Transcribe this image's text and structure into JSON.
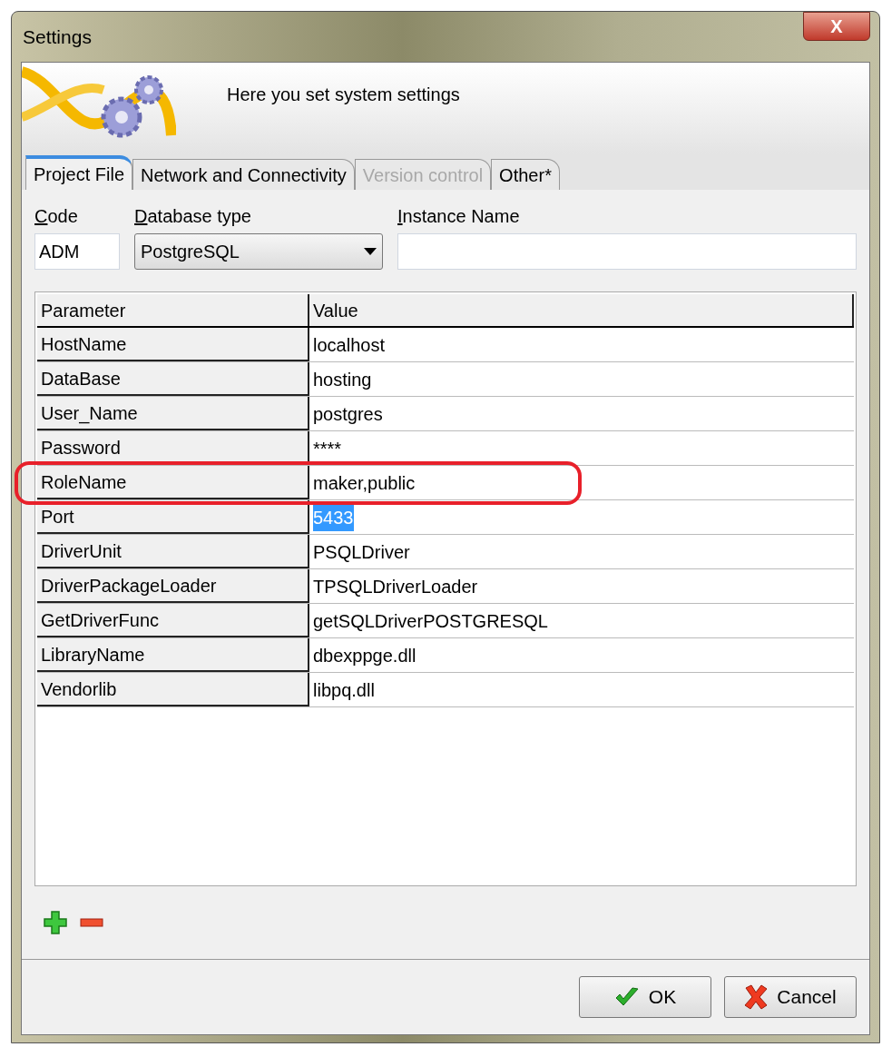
{
  "window": {
    "title": "Settings",
    "close_label": "X"
  },
  "header": {
    "text": "Here you set system settings"
  },
  "tabs": [
    {
      "label": "Project File",
      "selected": true,
      "disabled": false
    },
    {
      "label": "Network and Connectivity",
      "selected": false,
      "disabled": false
    },
    {
      "label": "Version control",
      "selected": false,
      "disabled": true
    },
    {
      "label": "Other*",
      "selected": false,
      "disabled": false
    }
  ],
  "fields": {
    "code": {
      "label": "Code",
      "value": "ADM"
    },
    "database_type": {
      "label": "Database type",
      "value": "PostgreSQL"
    },
    "instance_name": {
      "label": "Instance Name"
    }
  },
  "table": {
    "columns": [
      "Parameter",
      "Value"
    ],
    "rows": [
      {
        "parameter": "HostName",
        "value": "localhost",
        "selected": false
      },
      {
        "parameter": "DataBase",
        "value": "hosting",
        "selected": false
      },
      {
        "parameter": "User_Name",
        "value": "postgres",
        "selected": false
      },
      {
        "parameter": "Password",
        "value": "****",
        "selected": false
      },
      {
        "parameter": "RoleName",
        "value": "maker,public",
        "selected": false
      },
      {
        "parameter": "Port",
        "value": "5433",
        "selected": true
      },
      {
        "parameter": "DriverUnit",
        "value": "PSQLDriver",
        "selected": false
      },
      {
        "parameter": "DriverPackageLoader",
        "value": "TPSQLDriverLoader",
        "selected": false
      },
      {
        "parameter": "GetDriverFunc",
        "value": "getSQLDriverPOSTGRESQL",
        "selected": false
      },
      {
        "parameter": "LibraryName",
        "value": "dbexppge.dll",
        "selected": false
      },
      {
        "parameter": "Vendorlib",
        "value": "libpq.dll",
        "selected": false
      }
    ]
  },
  "buttons": [
    {
      "label": "OK",
      "kind": "ok"
    },
    {
      "label": "Cancel",
      "kind": "cancel"
    }
  ]
}
